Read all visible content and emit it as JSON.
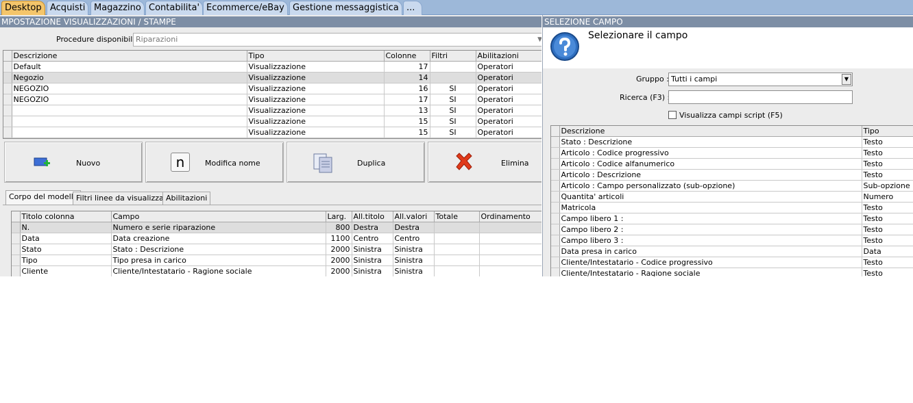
{
  "topbar": {
    "tabs": [
      "Desktop",
      "Acquisti",
      "Magazzino",
      "Contabilita'",
      "Ecommerce/eBay",
      "Gestione messaggistica",
      "..."
    ]
  },
  "left": {
    "title": "MPOSTAZIONE VISUALIZZAZIONI / STAMPE",
    "procedure_label": "Procedure disponibili :",
    "procedure_value": "Riparazioni",
    "models_table": {
      "headers": [
        "Descrizione",
        "Tipo",
        "Colonne",
        "Filtri",
        "Abilitazioni"
      ],
      "rows": [
        [
          "Default",
          "Visualizzazione",
          "17",
          "",
          "Operatori"
        ],
        [
          "Negozio",
          "Visualizzazione",
          "14",
          "",
          "Operatori"
        ],
        [
          "NEGOZIO",
          "Visualizzazione",
          "16",
          "SI",
          "Operatori"
        ],
        [
          "NEGOZIO",
          "Visualizzazione",
          "17",
          "SI",
          "Operatori"
        ],
        [
          "",
          "Visualizzazione",
          "13",
          "SI",
          "Operatori"
        ],
        [
          "",
          "Visualizzazione",
          "15",
          "SI",
          "Operatori"
        ],
        [
          "",
          "Visualizzazione",
          "15",
          "SI",
          "Operatori"
        ]
      ]
    },
    "buttons": {
      "new": "Nuovo",
      "rename": "Modifica nome",
      "duplicate": "Duplica",
      "delete": "Elimina",
      "rename_icon_letter": "n"
    },
    "tabs": [
      "Corpo del modello",
      "Filtri linee da visualizzare",
      "Abilitazioni"
    ],
    "columns_table": {
      "headers": [
        "Titolo colonna",
        "Campo",
        "Larg.",
        "All.titolo",
        "All.valori",
        "Totale",
        "Ordinamento"
      ],
      "rows": [
        [
          "N.",
          "Numero e serie riparazione",
          "800",
          "Destra",
          "Destra",
          "",
          ""
        ],
        [
          "Data",
          "Data creazione",
          "1100",
          "Centro",
          "Centro",
          "",
          ""
        ],
        [
          "Stato",
          "Stato : Descrizione",
          "2000",
          "Sinistra",
          "Sinistra",
          "",
          ""
        ],
        [
          "Tipo",
          "Tipo presa in carico",
          "2000",
          "Sinistra",
          "Sinistra",
          "",
          ""
        ],
        [
          "Cliente",
          "Cliente/Intestatario - Ragione sociale",
          "2000",
          "Sinistra",
          "Sinistra",
          "",
          ""
        ]
      ]
    }
  },
  "right": {
    "title": "SELEZIONE CAMPO",
    "heading": "Selezionare il campo",
    "group_label": "Gruppo :",
    "group_value": "Tutti i campi",
    "search_label": "Ricerca (F3) :",
    "search_value": "",
    "script_checkbox_label": "Visualizza campi script (F5)",
    "fields_table": {
      "headers": [
        "Descrizione",
        "Tipo"
      ],
      "rows": [
        [
          "Stato : Descrizione",
          "Testo"
        ],
        [
          "Articolo : Codice progressivo",
          "Testo"
        ],
        [
          "Articolo : Codice alfanumerico",
          "Testo"
        ],
        [
          "Articolo : Descrizione",
          "Testo"
        ],
        [
          "Articolo : Campo personalizzato (sub-opzione)",
          "Sub-opzione"
        ],
        [
          "Quantita' articoli",
          "Numero"
        ],
        [
          "Matricola",
          "Testo"
        ],
        [
          "Campo libero 1 :",
          "Testo"
        ],
        [
          "Campo libero 2 :",
          "Testo"
        ],
        [
          "Campo libero 3 :",
          "Testo"
        ],
        [
          "Data presa in carico",
          "Data"
        ],
        [
          "Cliente/Intestatario - Codice progressivo",
          "Testo"
        ],
        [
          "Cliente/Intestatario - Ragione sociale",
          "Testo"
        ]
      ]
    }
  },
  "colors": {
    "topbar": "#9db8d9",
    "active_tab": "#f4c56a",
    "titlebar": "#7d8ea5",
    "panel_bg": "#ececec",
    "delete_icon": "#e03a1a"
  }
}
